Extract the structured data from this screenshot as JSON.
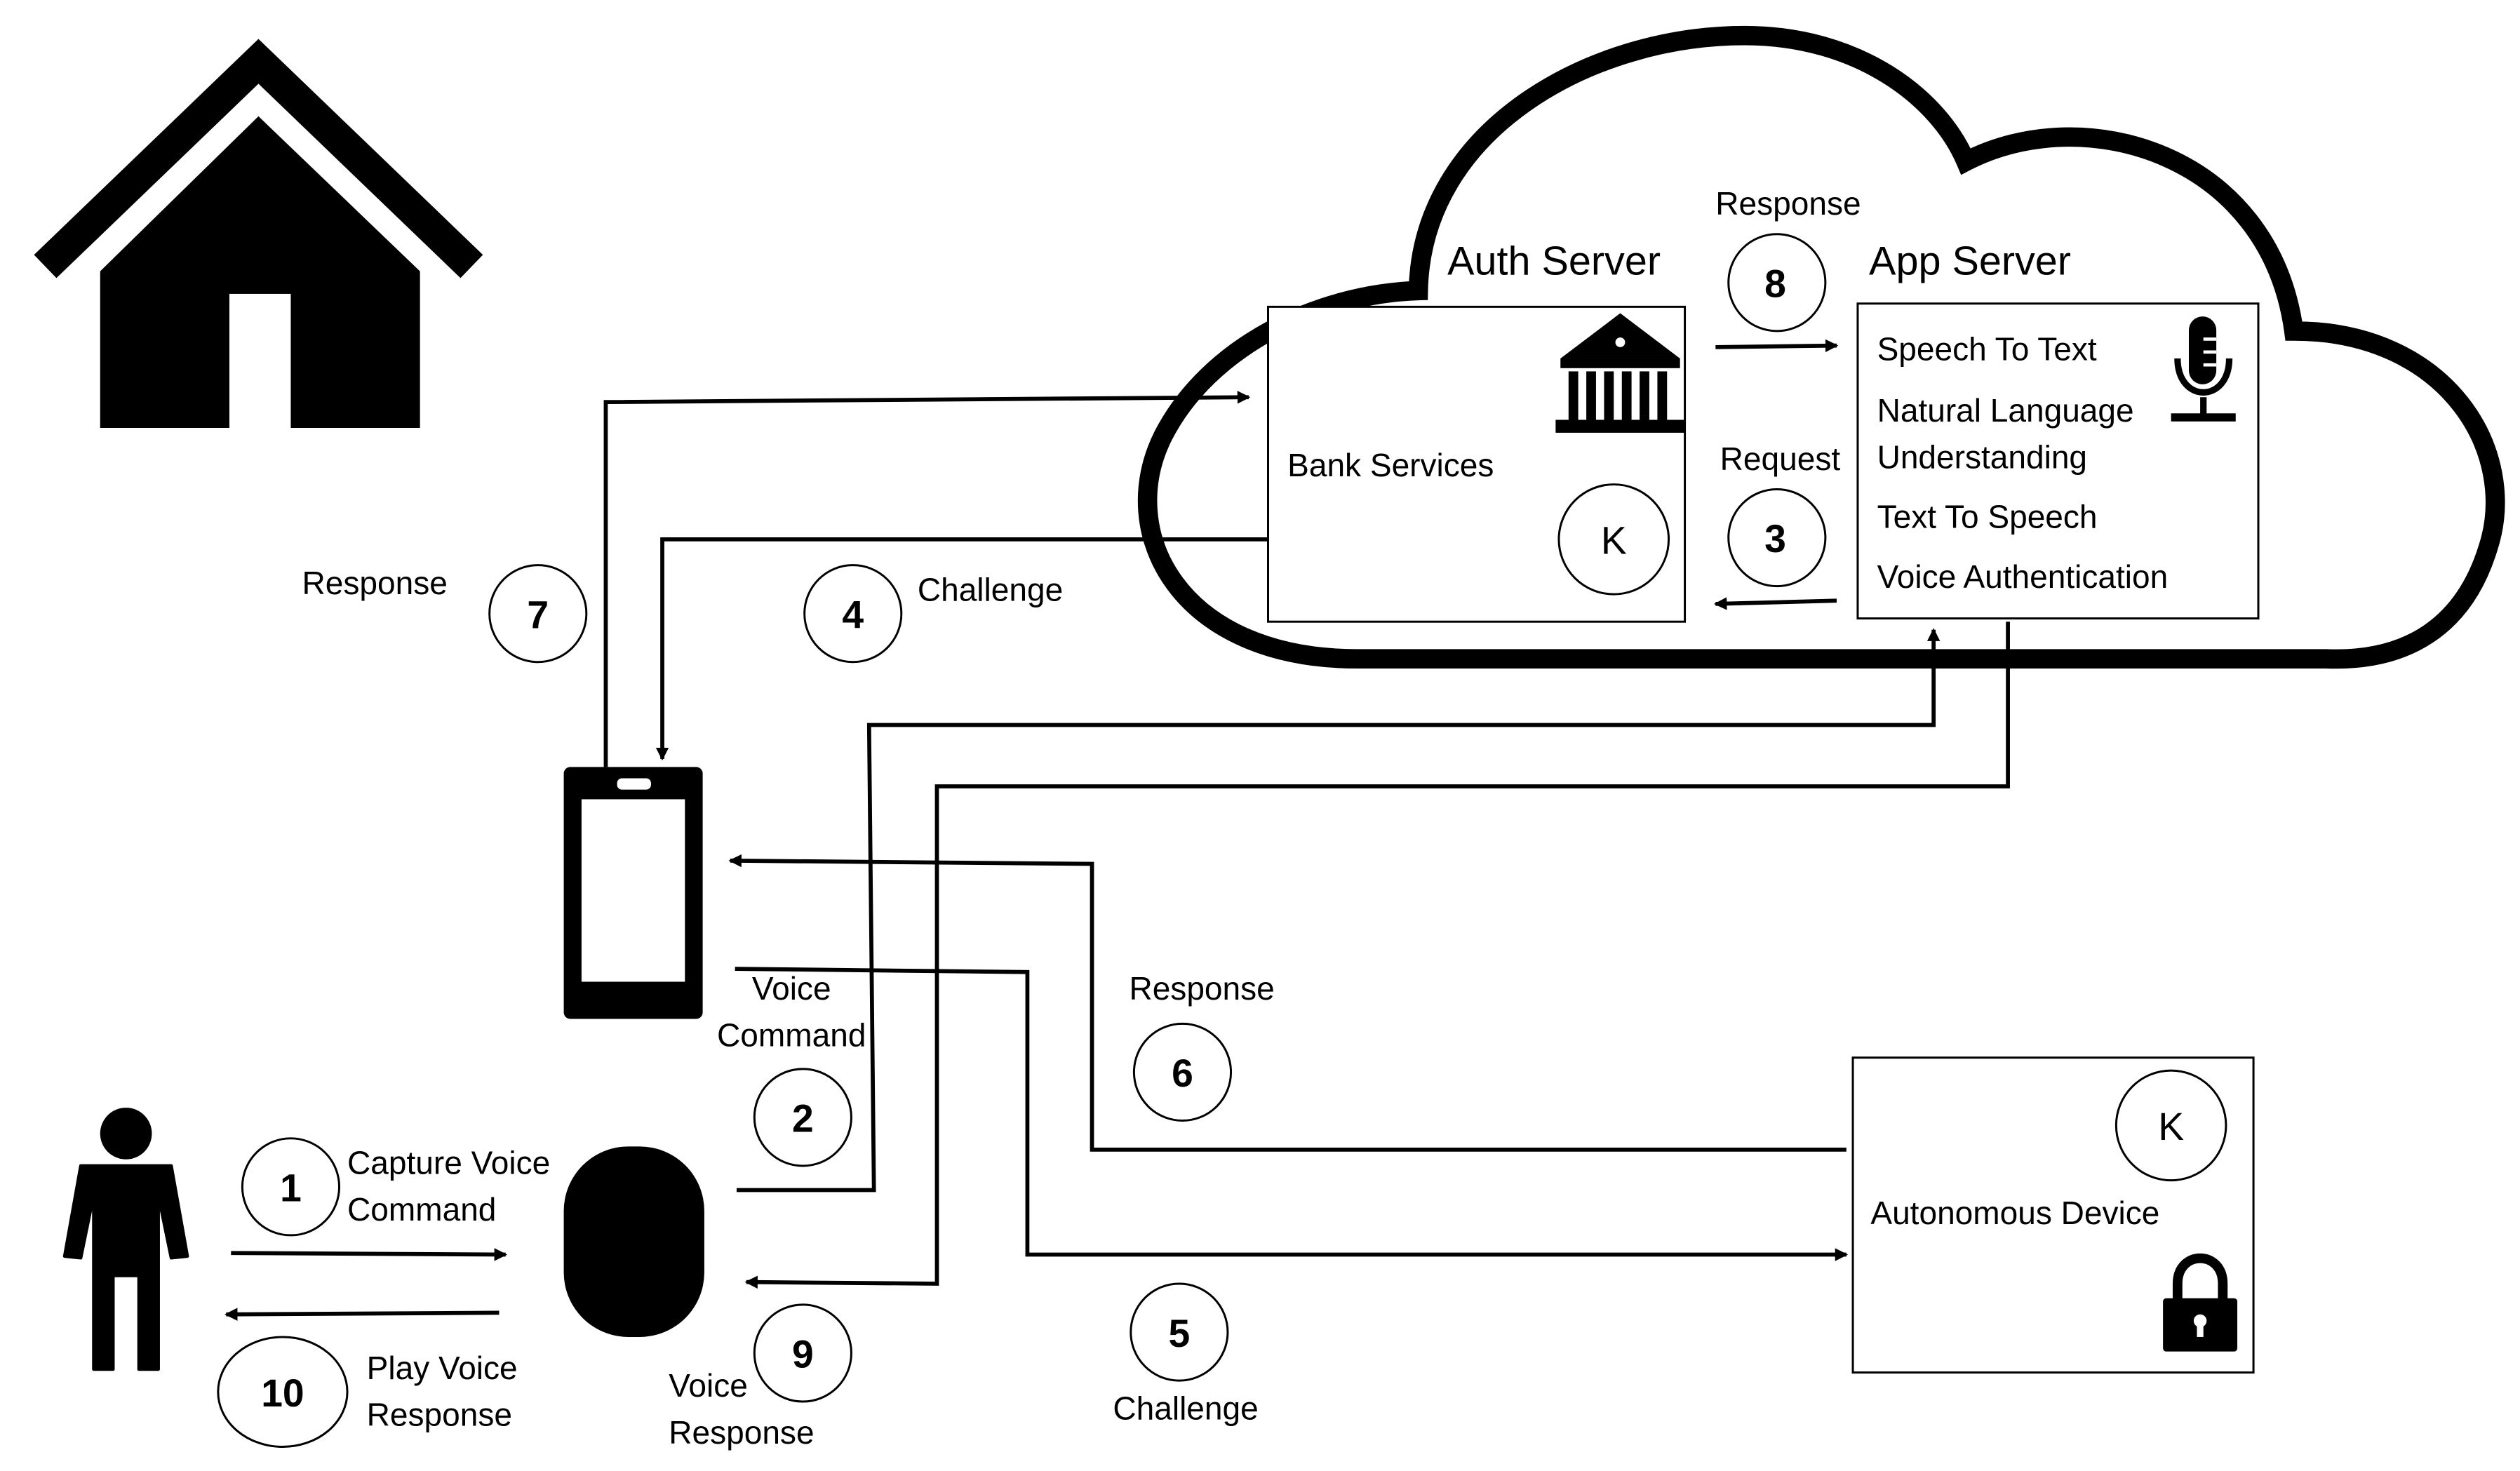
{
  "cloud": {
    "auth_server": {
      "title": "Auth Server",
      "service": "Bank Services",
      "key_label": "K",
      "icon": "bank-icon"
    },
    "app_server": {
      "title": "App Server",
      "services": [
        "Speech To Text",
        "Natural Language",
        "Understanding",
        "Text To Speech",
        "Voice Authentication"
      ],
      "icon": "microphone-icon"
    }
  },
  "autonomous_device": {
    "label": "Autonomous Device",
    "key_label": "K",
    "icon": "lock-icon"
  },
  "steps": [
    {
      "number": "1",
      "label": [
        "Capture Voice",
        "Command"
      ]
    },
    {
      "number": "2",
      "label": [
        "Voice",
        "Command"
      ]
    },
    {
      "number": "3",
      "label": [
        "Request"
      ]
    },
    {
      "number": "4",
      "label": [
        "Challenge"
      ]
    },
    {
      "number": "5",
      "label": [
        "Challenge"
      ]
    },
    {
      "number": "6",
      "label": [
        "Response"
      ]
    },
    {
      "number": "7",
      "label": [
        "Response"
      ]
    },
    {
      "number": "8",
      "label": [
        "Response"
      ]
    },
    {
      "number": "9",
      "label": [
        "Voice",
        "Response"
      ]
    },
    {
      "number": "10",
      "label": [
        "Play Voice",
        "Response"
      ]
    }
  ],
  "icons": [
    "house-icon",
    "person-icon",
    "smartphone-icon",
    "smart-speaker-icon",
    "cloud-icon"
  ]
}
